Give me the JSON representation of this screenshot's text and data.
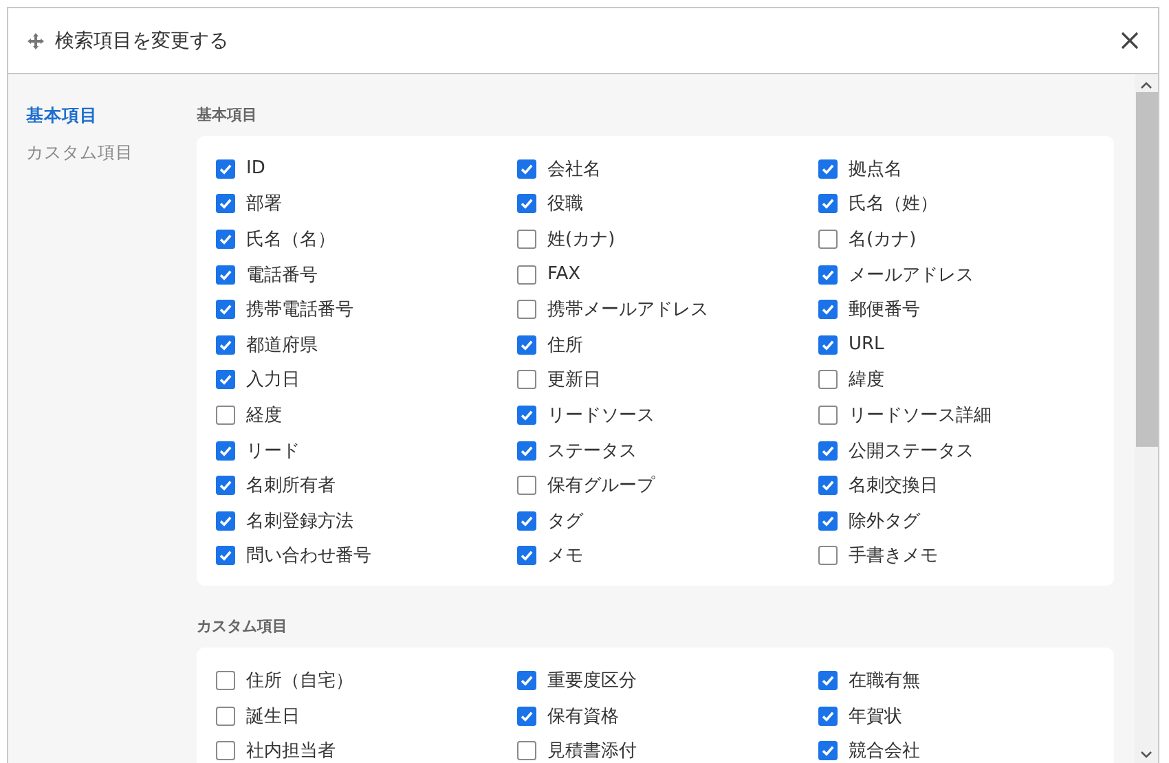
{
  "dialog": {
    "title": "検索項目を変更する"
  },
  "sidebar": {
    "items": [
      {
        "label": "基本項目",
        "selected": true
      },
      {
        "label": "カスタム項目",
        "selected": false
      }
    ]
  },
  "sections": [
    {
      "title": "基本項目",
      "items": [
        {
          "label": "ID",
          "checked": true
        },
        {
          "label": "会社名",
          "checked": true
        },
        {
          "label": "拠点名",
          "checked": true
        },
        {
          "label": "部署",
          "checked": true
        },
        {
          "label": "役職",
          "checked": true
        },
        {
          "label": "氏名（姓）",
          "checked": true
        },
        {
          "label": "氏名（名）",
          "checked": true
        },
        {
          "label": "姓(カナ)",
          "checked": false
        },
        {
          "label": "名(カナ)",
          "checked": false
        },
        {
          "label": "電話番号",
          "checked": true
        },
        {
          "label": "FAX",
          "checked": false
        },
        {
          "label": "メールアドレス",
          "checked": true
        },
        {
          "label": "携帯電話番号",
          "checked": true
        },
        {
          "label": "携帯メールアドレス",
          "checked": false
        },
        {
          "label": "郵便番号",
          "checked": true
        },
        {
          "label": "都道府県",
          "checked": true
        },
        {
          "label": "住所",
          "checked": true
        },
        {
          "label": "URL",
          "checked": true
        },
        {
          "label": "入力日",
          "checked": true
        },
        {
          "label": "更新日",
          "checked": false
        },
        {
          "label": "緯度",
          "checked": false
        },
        {
          "label": "経度",
          "checked": false
        },
        {
          "label": "リードソース",
          "checked": true
        },
        {
          "label": "リードソース詳細",
          "checked": false
        },
        {
          "label": "リード",
          "checked": true
        },
        {
          "label": "ステータス",
          "checked": true
        },
        {
          "label": "公開ステータス",
          "checked": true
        },
        {
          "label": "名刺所有者",
          "checked": true
        },
        {
          "label": "保有グループ",
          "checked": false
        },
        {
          "label": "名刺交換日",
          "checked": true
        },
        {
          "label": "名刺登録方法",
          "checked": true
        },
        {
          "label": "タグ",
          "checked": true
        },
        {
          "label": "除外タグ",
          "checked": true
        },
        {
          "label": "問い合わせ番号",
          "checked": true
        },
        {
          "label": "メモ",
          "checked": true
        },
        {
          "label": "手書きメモ",
          "checked": false
        }
      ]
    },
    {
      "title": "カスタム項目",
      "items": [
        {
          "label": "住所（自宅）",
          "checked": false
        },
        {
          "label": "重要度区分",
          "checked": true
        },
        {
          "label": "在職有無",
          "checked": true
        },
        {
          "label": "誕生日",
          "checked": false
        },
        {
          "label": "保有資格",
          "checked": true
        },
        {
          "label": "年賀状",
          "checked": true
        },
        {
          "label": "社内担当者",
          "checked": false
        },
        {
          "label": "見積書添付",
          "checked": false
        },
        {
          "label": "競合会社",
          "checked": true
        }
      ]
    }
  ]
}
